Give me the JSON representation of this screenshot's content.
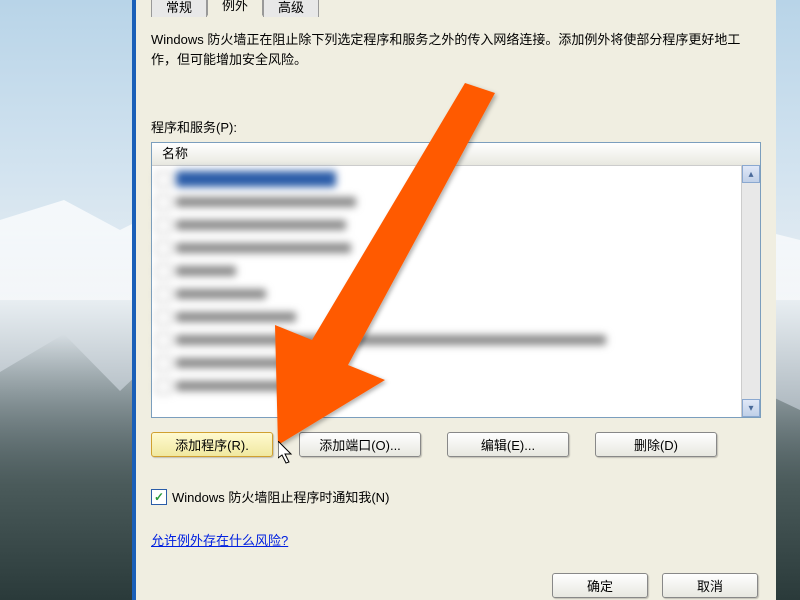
{
  "tabs": {
    "general": "常规",
    "exceptions": "例外",
    "advanced": "高级"
  },
  "description": "Windows 防火墙正在阻止除下列选定程序和服务之外的传入网络连接。添加例外将使部分程序更好地工作，但可能增加安全风险。",
  "list": {
    "label": "程序和服务(P):",
    "header": "名称"
  },
  "buttons": {
    "addProgram": "添加程序(R).",
    "addPort": "添加端口(O)...",
    "edit": "编辑(E)...",
    "delete": "删除(D)"
  },
  "checkbox": {
    "label": "Windows 防火墙阻止程序时通知我(N)"
  },
  "link": {
    "text": "允许例外存在什么风险?"
  },
  "dialog": {
    "ok": "确定",
    "cancel": "取消"
  }
}
